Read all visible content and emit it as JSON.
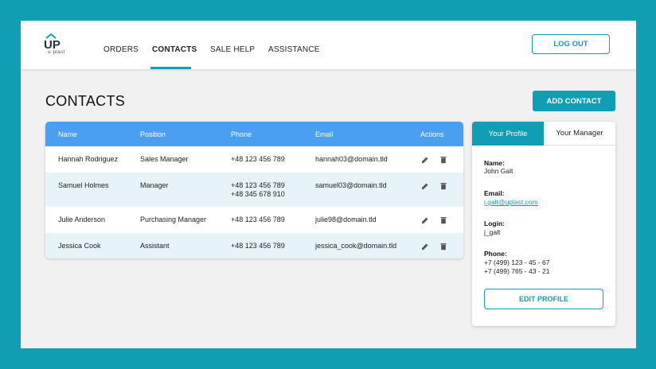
{
  "brand": {
    "logo_text": "UP",
    "logo_sub": "u·plast"
  },
  "nav": {
    "items": [
      {
        "label": "ORDERS"
      },
      {
        "label": "CONTACTS"
      },
      {
        "label": "SALE HELP"
      },
      {
        "label": "ASSISTANCE"
      }
    ],
    "active": "CONTACTS"
  },
  "header": {
    "logout_label": "LOG OUT"
  },
  "page": {
    "title": "CONTACTS",
    "add_label": "ADD CONTACT"
  },
  "table": {
    "columns": [
      "Name",
      "Position",
      "Phone",
      "Email",
      "Actions"
    ],
    "rows": [
      {
        "name": "Hannah Rodriguez",
        "position": "Sales Manager",
        "phone": [
          "+48 123 456 789"
        ],
        "email": "hannah03@domain.tld"
      },
      {
        "name": "Samuel Holmes",
        "position": "Manager",
        "phone": [
          "+48 123 456 789",
          "+48 345 678 910"
        ],
        "email": "samuel03@domain.tld"
      },
      {
        "name": "Julie Anderson",
        "position": "Purchasing Manager",
        "phone": [
          "+48 123 456 789"
        ],
        "email": "julie98@domain.tld"
      },
      {
        "name": "Jessica Cook",
        "position": "Assistant",
        "phone": [
          "+48 123 456 789"
        ],
        "email": "jessica_cook@domain.tld"
      }
    ]
  },
  "profile": {
    "tabs": [
      "Your Profile",
      "Your Manager"
    ],
    "active_tab": "Your Profile",
    "name_label": "Name:",
    "name": "John Galt",
    "email_label": "Email:",
    "email": "j.galt@uplast.com",
    "login_label": "Login:",
    "login": "j_galt",
    "phone_label": "Phone:",
    "phones": [
      "+7 (499) 123 - 45 - 67",
      "+7 (499) 765 - 43 - 21"
    ],
    "edit_label": "EDIT PROFILE"
  },
  "colors": {
    "accent": "#0f9eb3",
    "table_header": "#4a9ff0",
    "alt_row": "#e6f4f8"
  },
  "icons": {
    "edit": "pencil-icon",
    "delete": "trash-icon"
  }
}
